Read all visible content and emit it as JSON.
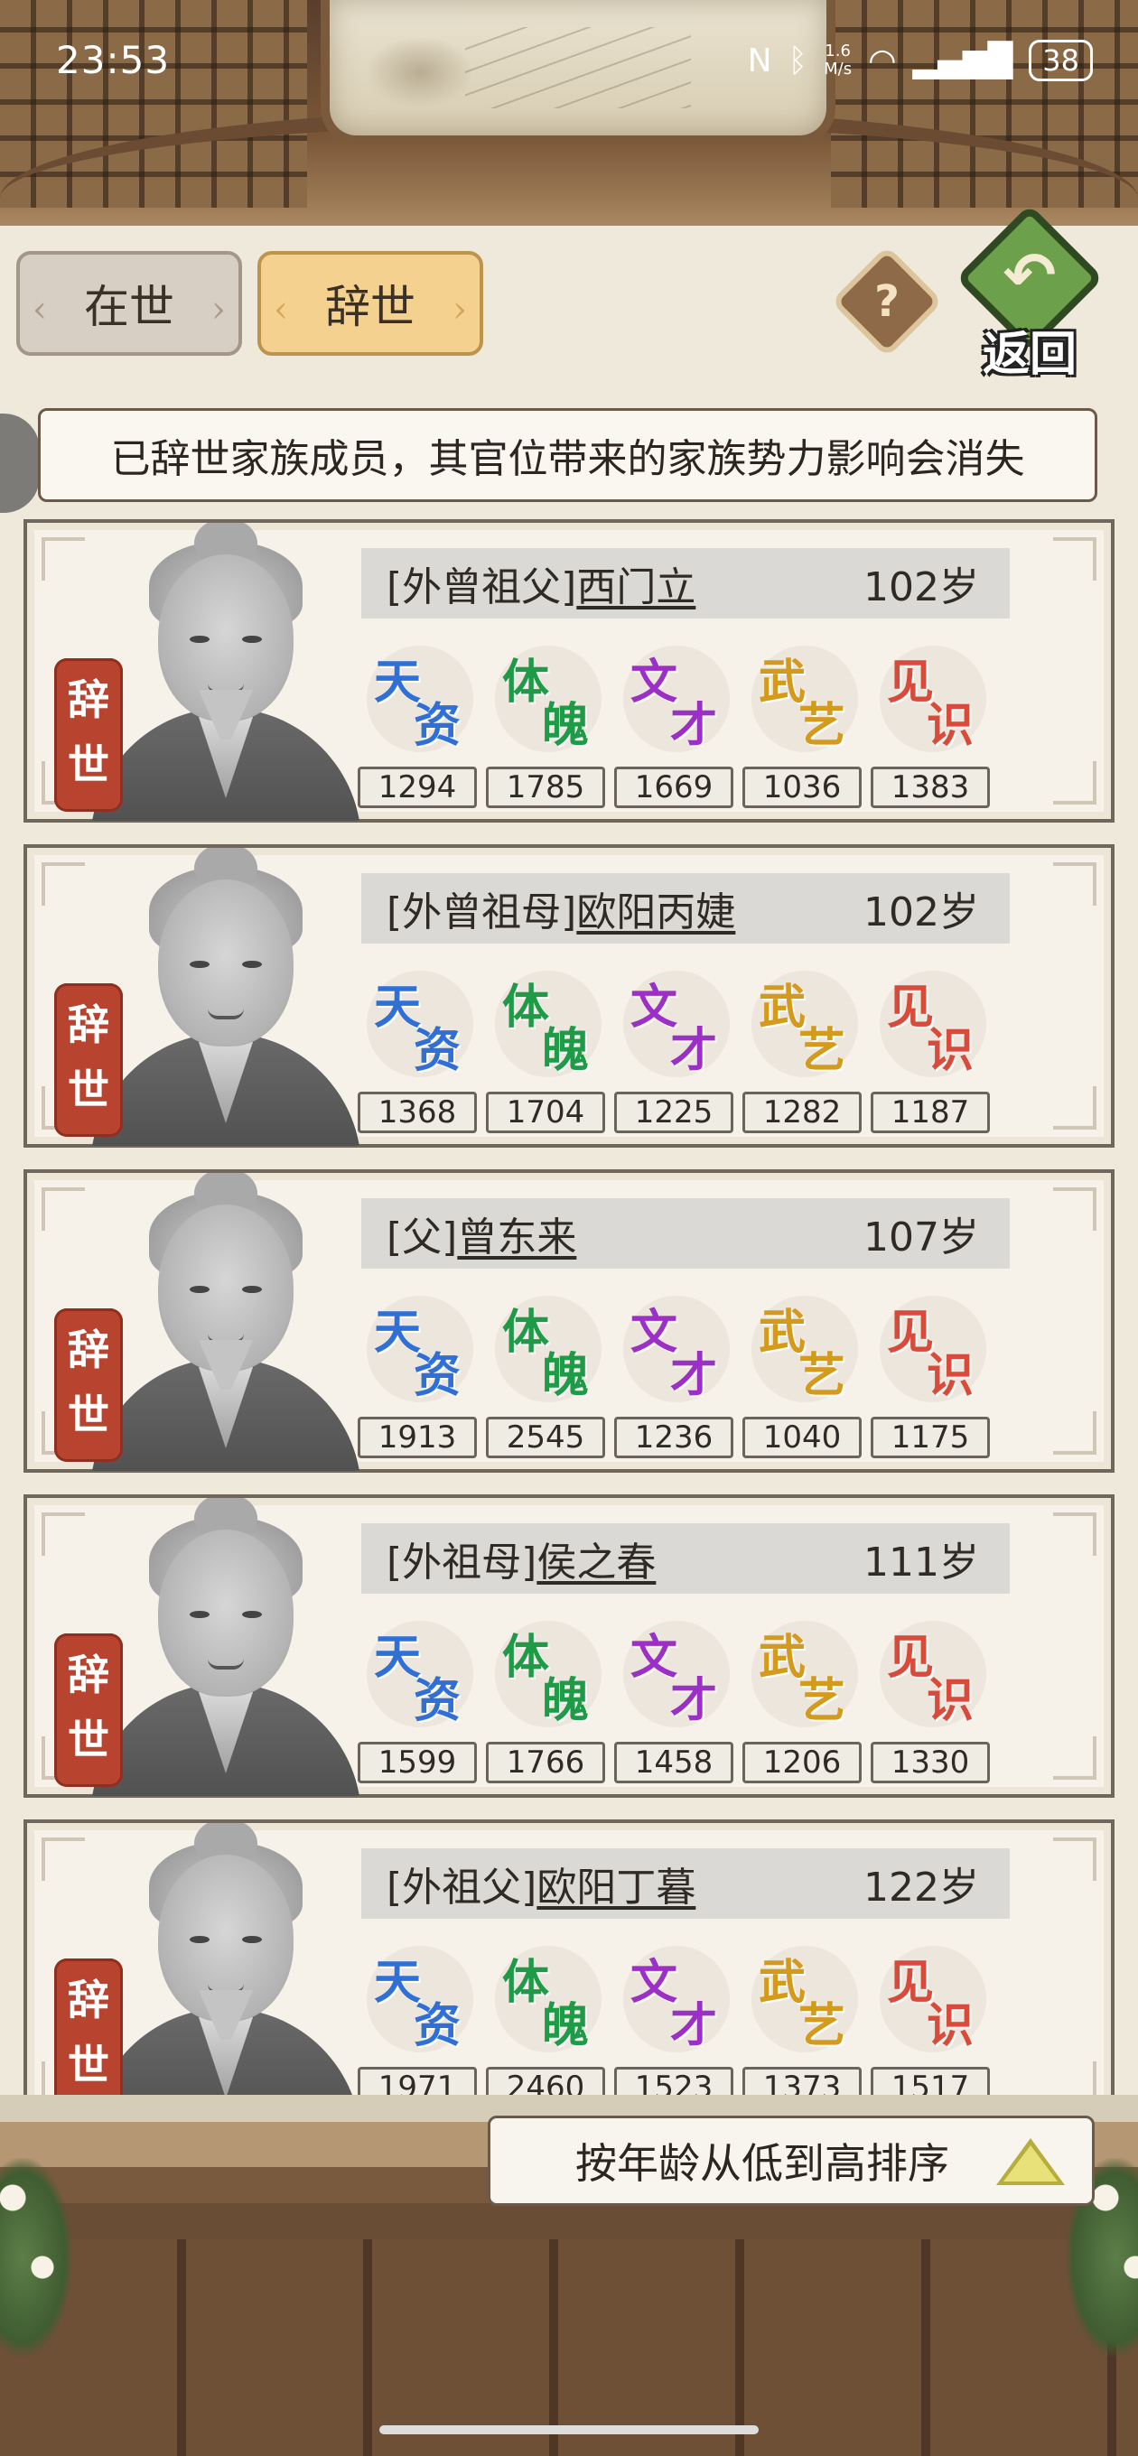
{
  "status_bar": {
    "time": "23:53",
    "net_speed_top": "1.6",
    "net_speed_bottom": "M/s",
    "battery": "38",
    "icons": [
      "nfc-icon",
      "bluetooth-icon",
      "wifi-icon",
      "signal-icon",
      "battery-icon"
    ]
  },
  "tabs": {
    "alive": "在世",
    "deceased": "辞世"
  },
  "help_button": {
    "icon": "question-icon",
    "label": "?"
  },
  "back_button": {
    "label": "返回",
    "icon": "return-arrow-icon"
  },
  "notice": "已辞世家族成员，其官位带来的家族势力影响会消失",
  "stat_labels": [
    {
      "chars": [
        "天",
        "资"
      ],
      "color": "#2f6fd6"
    },
    {
      "chars": [
        "体",
        "魄"
      ],
      "color": "#1f9a47"
    },
    {
      "chars": [
        "文",
        "才"
      ],
      "color": "#9b2fc7"
    },
    {
      "chars": [
        "武",
        "艺"
      ],
      "color": "#d49a1b"
    },
    {
      "chars": [
        "见",
        "识"
      ],
      "color": "#d84a3a"
    }
  ],
  "stamp": {
    "c1": "辞",
    "c2": "世"
  },
  "members": [
    {
      "kinship": "[外曾祖父]",
      "name": "西门立",
      "age": "102岁",
      "stats": [
        "1294",
        "1785",
        "1669",
        "1036",
        "1383"
      ]
    },
    {
      "kinship": "[外曾祖母]",
      "name": "欧阳丙婕",
      "age": "102岁",
      "stats": [
        "1368",
        "1704",
        "1225",
        "1282",
        "1187"
      ]
    },
    {
      "kinship": "[父]",
      "name": "曾东来",
      "age": "107岁",
      "stats": [
        "1913",
        "2545",
        "1236",
        "1040",
        "1175"
      ]
    },
    {
      "kinship": "[外祖母]",
      "name": "侯之春",
      "age": "111岁",
      "stats": [
        "1599",
        "1766",
        "1458",
        "1206",
        "1330"
      ]
    },
    {
      "kinship": "[外祖父]",
      "name": "欧阳丁暮",
      "age": "122岁",
      "stats": [
        "1971",
        "2460",
        "1523",
        "1373",
        "1517"
      ]
    }
  ],
  "sort_button": {
    "label": "按年龄从低到高排序",
    "icon": "triangle-up-icon"
  }
}
